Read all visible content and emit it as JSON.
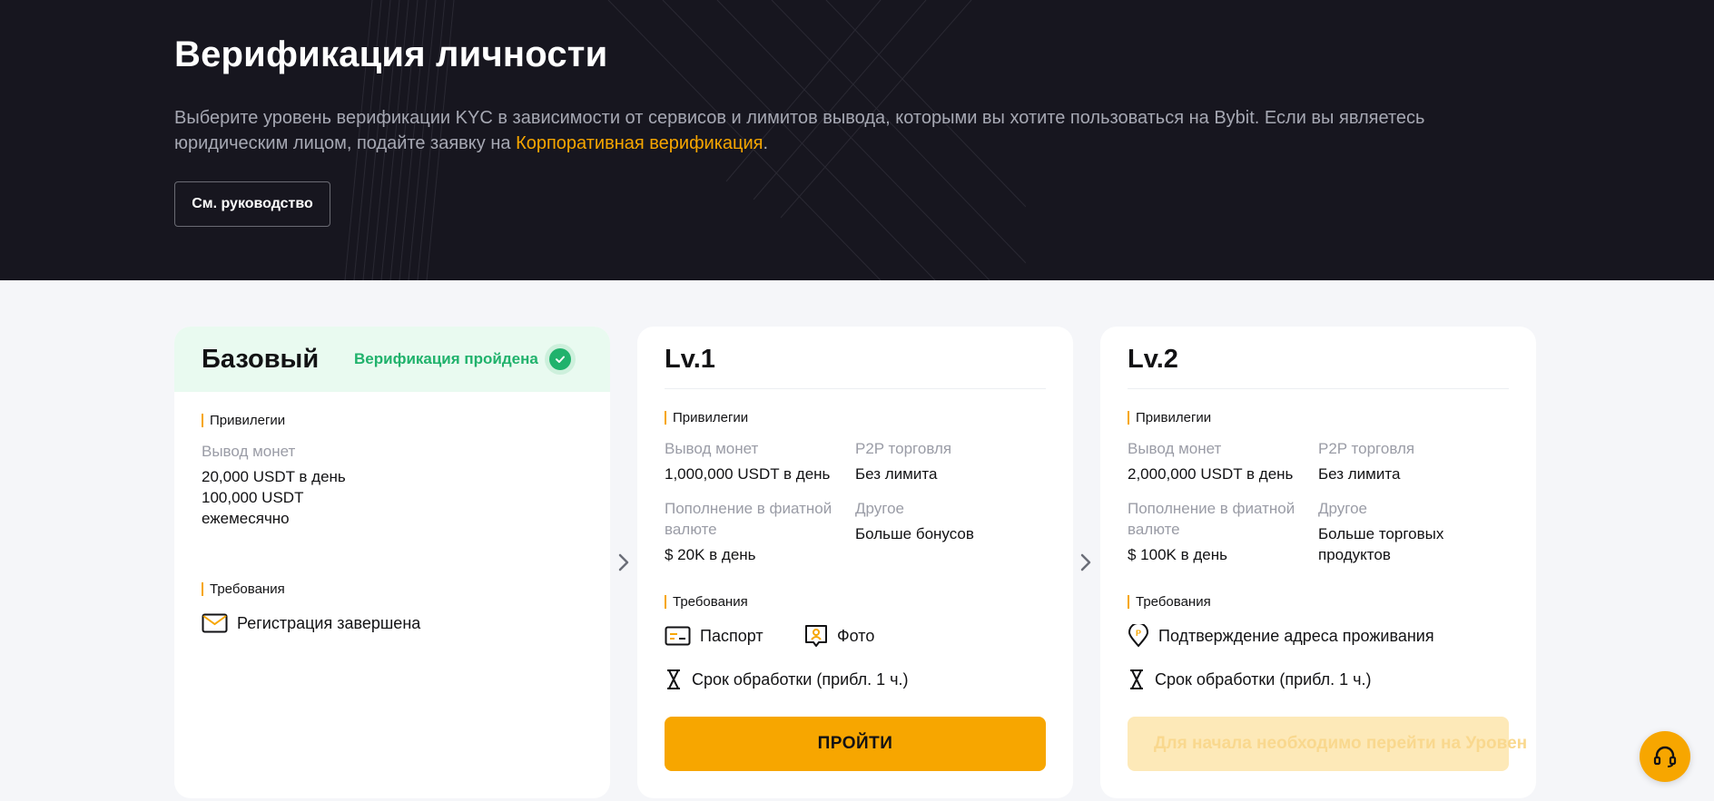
{
  "hero": {
    "title": "Верификация личности",
    "description": "Выберите уровень верификации KYC в зависимости от сервисов и лимитов вывода, которыми вы хотите пользоваться на Bybit. Если вы являетесь юридическим лицом, подайте заявку на ",
    "corporate_link": "Корпоративная верификация",
    "description_end": ".",
    "guide_button": "См. руководство"
  },
  "colors": {
    "accent": "#f7a600",
    "success": "#20b26c",
    "hero_bg": "#17161f",
    "page_bg": "#f5f6f9"
  },
  "cards": {
    "basic": {
      "title": "Базовый",
      "status": "Верификация пройдена",
      "privileges_label": "Привилегии",
      "withdraw_label": "Вывод монет",
      "withdraw_day": "20,000 USDT в день",
      "withdraw_month": "100,000 USDT",
      "withdraw_month_2": "ежемесячно",
      "requirements_label": "Требования",
      "req_registration": "Регистрация завершена",
      "req_registration_icon": "envelope-icon"
    },
    "lv1": {
      "title": "Lv.1",
      "privileges_label": "Привилегии",
      "withdraw_label": "Вывод монет",
      "withdraw_value": "1,000,000 USDT в день",
      "p2p_label": "P2P торговля",
      "p2p_value": "Без лимита",
      "fiat_label_1": "Пополнение в фиатной",
      "fiat_label_2": "валюте",
      "fiat_value": "$ 20K в день",
      "other_label": "Другое",
      "other_value": "Больше бонусов",
      "requirements_label": "Требования",
      "req_passport": "Паспорт",
      "req_photo": "Фото",
      "req_time": "Срок обработки (прибл. 1 ч.)",
      "button": "ПРОЙТИ"
    },
    "lv2": {
      "title": "Lv.2",
      "privileges_label": "Привилегии",
      "withdraw_label": "Вывод монет",
      "withdraw_value": "2,000,000 USDT в день",
      "p2p_label": "P2P торговля",
      "p2p_value": "Без лимита",
      "fiat_label_1": "Пополнение в фиатной",
      "fiat_label_2": "валюте",
      "fiat_value": "$ 100K в день",
      "other_label": "Другое",
      "other_value_1": "Больше торговых",
      "other_value_2": "продуктов",
      "requirements_label": "Требования",
      "req_address": "Подтверждение адреса проживания",
      "req_time": "Срок обработки (прибл. 1 ч.)",
      "button": "Для начала необходимо перейти на Уровен"
    }
  }
}
